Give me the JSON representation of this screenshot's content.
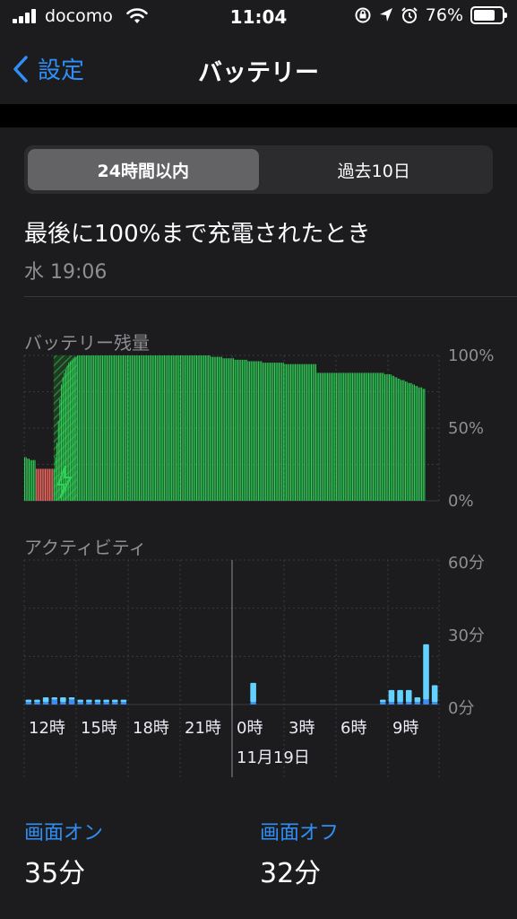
{
  "status_bar": {
    "carrier": "docomo",
    "time": "11:04",
    "battery_percent": "76%",
    "battery_level": 0.76,
    "icons": [
      "signal-icon",
      "wifi-icon",
      "orientation-lock-icon",
      "location-icon",
      "alarm-icon",
      "battery-icon"
    ]
  },
  "nav": {
    "back_label": "設定",
    "title": "バッテリー"
  },
  "segments": [
    {
      "label": "24時間以内",
      "active": true
    },
    {
      "label": "過去10日",
      "active": false
    }
  ],
  "last_charge": {
    "title": "最後に100%まで充電されたとき",
    "time": "水 19:06"
  },
  "colors": {
    "accent": "#2f8ff7",
    "battery_green": "#30d158",
    "battery_red": "#ff6b63",
    "activity_dark": "#3a8df7",
    "activity_light": "#64d2ff"
  },
  "chart_data": [
    {
      "type": "bar",
      "title": "バッテリー残量",
      "y_ticks": [
        "100%",
        "50%",
        "0%"
      ],
      "ylim": [
        0,
        100
      ],
      "values": [
        30,
        30,
        29,
        29,
        28,
        28,
        28,
        28,
        22,
        22,
        22,
        22,
        22,
        22,
        22,
        22,
        22,
        22,
        22,
        22,
        22,
        30,
        40,
        55,
        70,
        80,
        85,
        88,
        90,
        93,
        95,
        96,
        97,
        98,
        99,
        99,
        100,
        100,
        100,
        100,
        100,
        100,
        100,
        100,
        100,
        100,
        100,
        100,
        100,
        100,
        100,
        100,
        100,
        100,
        100,
        100,
        100,
        100,
        100,
        100,
        100,
        100,
        100,
        100,
        100,
        100,
        100,
        100,
        100,
        100,
        100,
        100,
        100,
        100,
        100,
        100,
        100,
        100,
        100,
        100,
        100,
        100,
        100,
        100,
        100,
        100,
        100,
        100,
        100,
        100,
        100,
        100,
        100,
        100,
        100,
        100,
        100,
        100,
        100,
        100,
        100,
        100,
        100,
        100,
        100,
        100,
        100,
        100,
        100,
        100,
        100,
        100,
        100,
        100,
        100,
        100,
        100,
        100,
        100,
        100,
        100,
        100,
        100,
        100,
        100,
        100,
        100,
        99,
        99,
        99,
        99,
        99,
        99,
        99,
        99,
        98,
        98,
        98,
        98,
        98,
        98,
        98,
        98,
        97,
        97,
        97,
        97,
        97,
        97,
        97,
        97,
        97,
        96,
        96,
        96,
        96,
        96,
        96,
        96,
        96,
        96,
        96,
        95,
        95,
        95,
        95,
        95,
        95,
        95,
        95,
        95,
        95,
        95,
        95,
        95,
        95,
        95,
        94,
        94,
        94,
        94,
        94,
        94,
        94,
        94,
        94,
        94,
        94,
        94,
        94,
        94,
        94,
        94,
        94,
        94,
        94,
        94,
        94,
        94,
        88,
        88,
        88,
        88,
        88,
        88,
        88,
        88,
        88,
        88,
        88,
        88,
        88,
        88,
        88,
        88,
        88,
        88,
        88,
        88,
        88,
        88,
        88,
        88,
        88,
        88,
        88,
        88,
        88,
        88,
        88,
        88,
        88,
        88,
        88,
        88,
        88,
        88,
        88,
        88,
        88,
        88,
        88,
        88,
        88,
        88,
        87,
        87,
        87,
        87,
        87,
        86,
        86,
        85,
        85,
        84,
        84,
        83,
        83,
        83,
        82,
        82,
        81,
        81,
        81,
        80,
        80,
        79,
        79,
        78,
        78,
        78,
        77,
        77
      ],
      "low_power_range": [
        8,
        20
      ],
      "charging_range": [
        20,
        36
      ]
    },
    {
      "type": "bar",
      "title": "アクティビティ",
      "y_ticks": [
        "60分",
        "30分",
        "0分"
      ],
      "ylim": [
        0,
        60
      ],
      "categories": [
        "12時",
        "15時",
        "18時",
        "21時",
        "0時",
        "3時",
        "6時",
        "9時"
      ],
      "date_label": "11月19日",
      "screen_on": [
        1,
        1,
        1,
        2,
        1,
        2,
        1,
        1,
        1,
        1,
        1,
        1,
        0,
        0,
        0,
        0,
        0,
        0,
        0,
        0,
        0,
        0,
        0,
        0,
        0,
        0,
        1,
        0,
        0,
        0,
        0,
        0,
        0,
        0,
        0,
        0,
        0,
        0,
        0,
        0,
        0,
        1,
        1,
        1,
        1,
        1,
        2,
        1
      ],
      "screen_off": [
        1,
        1,
        2,
        1,
        2,
        1,
        1,
        1,
        1,
        1,
        1,
        1,
        0,
        0,
        0,
        0,
        0,
        0,
        0,
        0,
        0,
        0,
        0,
        0,
        0,
        0,
        8,
        0,
        0,
        0,
        0,
        0,
        0,
        0,
        0,
        0,
        0,
        0,
        0,
        0,
        0,
        1,
        5,
        5,
        5,
        2,
        23,
        7
      ]
    }
  ],
  "summary": {
    "screen_on_label": "画面オン",
    "screen_on_value": "35分",
    "screen_off_label": "画面オフ",
    "screen_off_value": "32分"
  }
}
